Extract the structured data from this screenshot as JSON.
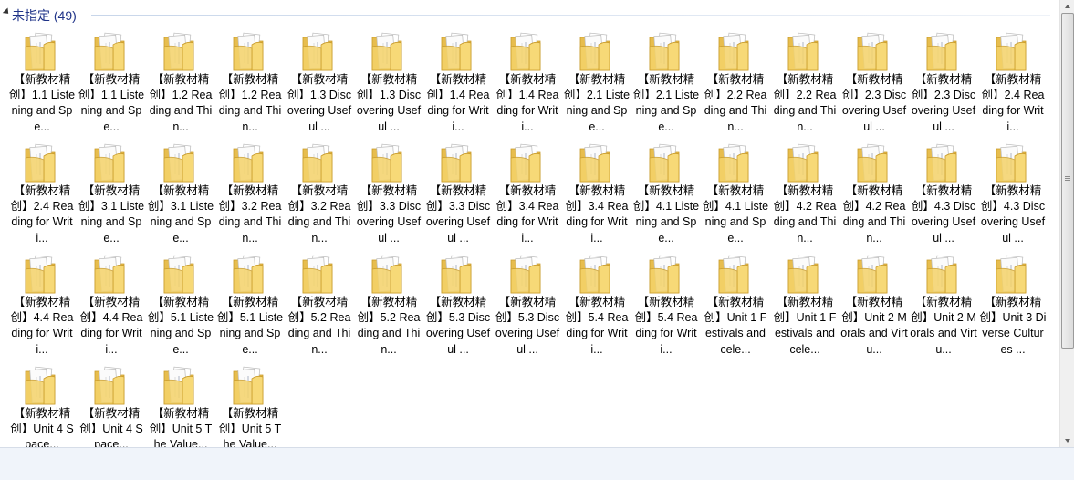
{
  "group": {
    "title": "未指定 (49)"
  },
  "icons": {
    "folder": "folder-icon",
    "collapse": "collapse-arrow-icon",
    "scroll_up": "scroll-up-icon",
    "scroll_down": "scroll-down-icon"
  },
  "colors": {
    "group_title": "#1e3287",
    "folder_body": "#f4d36a",
    "status_bar": "#f0f4fa"
  },
  "items": [
    {
      "label": "【新教材精创】1.1 Listening and Spe..."
    },
    {
      "label": "【新教材精创】1.1 Listening and Spe..."
    },
    {
      "label": "【新教材精创】1.2 Reading and Thin..."
    },
    {
      "label": "【新教材精创】1.2 Reading and Thin..."
    },
    {
      "label": "【新教材精创】1.3 Discovering Useful ..."
    },
    {
      "label": "【新教材精创】1.3 Discovering Useful ..."
    },
    {
      "label": "【新教材精创】1.4 Reading for Writi..."
    },
    {
      "label": "【新教材精创】1.4 Reading for Writi..."
    },
    {
      "label": "【新教材精创】2.1 Listening and Spe..."
    },
    {
      "label": "【新教材精创】2.1 Listening and Spe..."
    },
    {
      "label": "【新教材精创】2.2 Reading and Thin..."
    },
    {
      "label": "【新教材精创】2.2 Reading and Thin..."
    },
    {
      "label": "【新教材精创】2.3 Discovering Useful ..."
    },
    {
      "label": "【新教材精创】2.3 Discovering Useful ..."
    },
    {
      "label": "【新教材精创】2.4 Reading for Writi..."
    },
    {
      "label": "【新教材精创】2.4 Reading for Writi..."
    },
    {
      "label": "【新教材精创】3.1 Listening and Spe..."
    },
    {
      "label": "【新教材精创】3.1 Listening and Spe..."
    },
    {
      "label": "【新教材精创】3.2 Reading and Thin..."
    },
    {
      "label": "【新教材精创】3.2 Reading and Thin..."
    },
    {
      "label": "【新教材精创】3.3 Discovering Useful ..."
    },
    {
      "label": "【新教材精创】3.3 Discovering Useful ..."
    },
    {
      "label": "【新教材精创】3.4 Reading for Writi..."
    },
    {
      "label": "【新教材精创】3.4 Reading for Writi..."
    },
    {
      "label": "【新教材精创】4.1 Listening and Spe..."
    },
    {
      "label": "【新教材精创】4.1 Listening and Spe..."
    },
    {
      "label": "【新教材精创】4.2 Reading and Thin..."
    },
    {
      "label": "【新教材精创】4.2 Reading and Thin..."
    },
    {
      "label": "【新教材精创】4.3 Discovering Useful ..."
    },
    {
      "label": "【新教材精创】4.3 Discovering Useful ..."
    },
    {
      "label": "【新教材精创】4.4 Reading for Writi..."
    },
    {
      "label": "【新教材精创】4.4 Reading for Writi..."
    },
    {
      "label": "【新教材精创】5.1 Listening and Spe..."
    },
    {
      "label": "【新教材精创】5.1 Listening and Spe..."
    },
    {
      "label": "【新教材精创】5.2 Reading and Thin..."
    },
    {
      "label": "【新教材精创】5.2 Reading and Thin..."
    },
    {
      "label": "【新教材精创】5.3 Discovering Useful ..."
    },
    {
      "label": "【新教材精创】5.3 Discovering Useful ..."
    },
    {
      "label": "【新教材精创】5.4 Reading for Writi..."
    },
    {
      "label": "【新教材精创】5.4 Reading for Writi..."
    },
    {
      "label": "【新教材精创】Unit 1 Festivals and cele..."
    },
    {
      "label": "【新教材精创】Unit 1 Festivals and cele..."
    },
    {
      "label": "【新教材精创】Unit 2 Morals and Virtu..."
    },
    {
      "label": "【新教材精创】Unit 2 Morals and Virtu..."
    },
    {
      "label": "【新教材精创】Unit 3 Diverse Cultures ..."
    },
    {
      "label": "【新教材精创】Unit 4 Space..."
    },
    {
      "label": "【新教材精创】Unit 4 Space..."
    },
    {
      "label": "【新教材精创】Unit 5 The Value..."
    },
    {
      "label": "【新教材精创】Unit 5 The Value..."
    }
  ]
}
